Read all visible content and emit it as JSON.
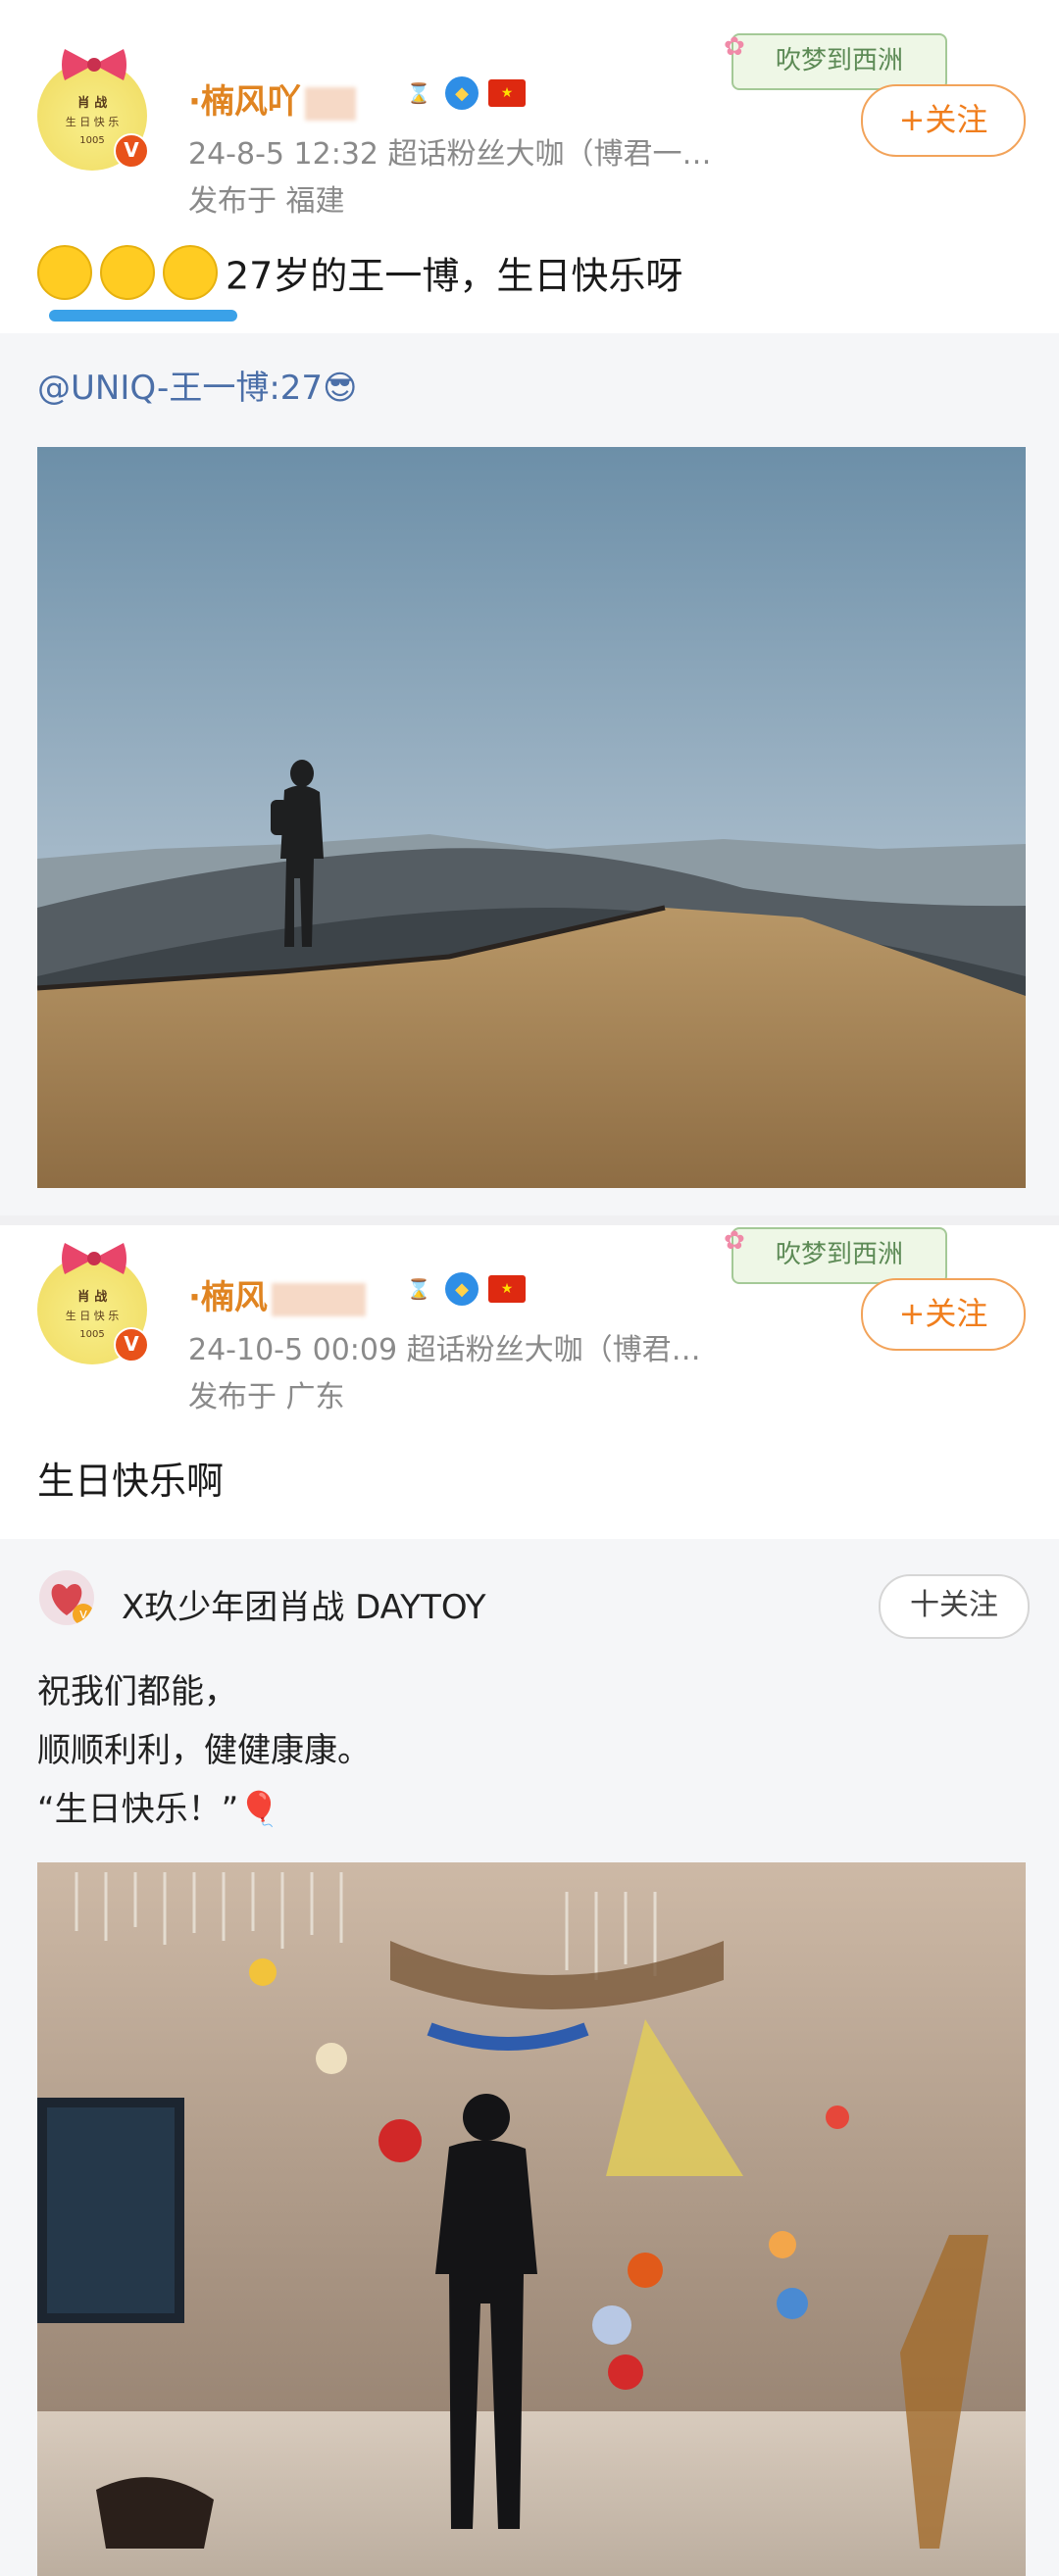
{
  "post1": {
    "avatar_text_top": "肖 战",
    "avatar_text_mid": "生 日 快 乐",
    "avatar_text_bottom": "1005",
    "username": "·楠风吖",
    "meta": "24-8-5 12:32  超话粉丝大咖（博君一…",
    "location": "发布于 福建",
    "decor_label": "吹梦到西洲",
    "follow_label": "+关注",
    "content": "27岁的王一博，生日快乐呀",
    "repost_mention": "@UNIQ-王一博:27😎"
  },
  "post2": {
    "avatar_text_top": "肖 战",
    "avatar_text_mid": "生 日 快 乐",
    "avatar_text_bottom": "1005",
    "username": "·楠风",
    "meta": "24-10-5 00:09  超话粉丝大咖（博君…",
    "location": "发布于 广东",
    "decor_label": "吹梦到西洲",
    "follow_label": "+关注",
    "content": "生日快乐啊",
    "repost_name": "X玖少年团肖战 DAYTOY",
    "repost_follow": "十关注",
    "repost_lines": [
      "祝我们都能，",
      "顺顺利利，健健康康。",
      "“生日快乐！”🎈"
    ]
  },
  "colors": {
    "username": "#e08421",
    "follow_border": "#f2a35a",
    "mention": "#4b6fa8",
    "meta": "#8a8a8a",
    "repost_bg": "#f5f6f8"
  }
}
